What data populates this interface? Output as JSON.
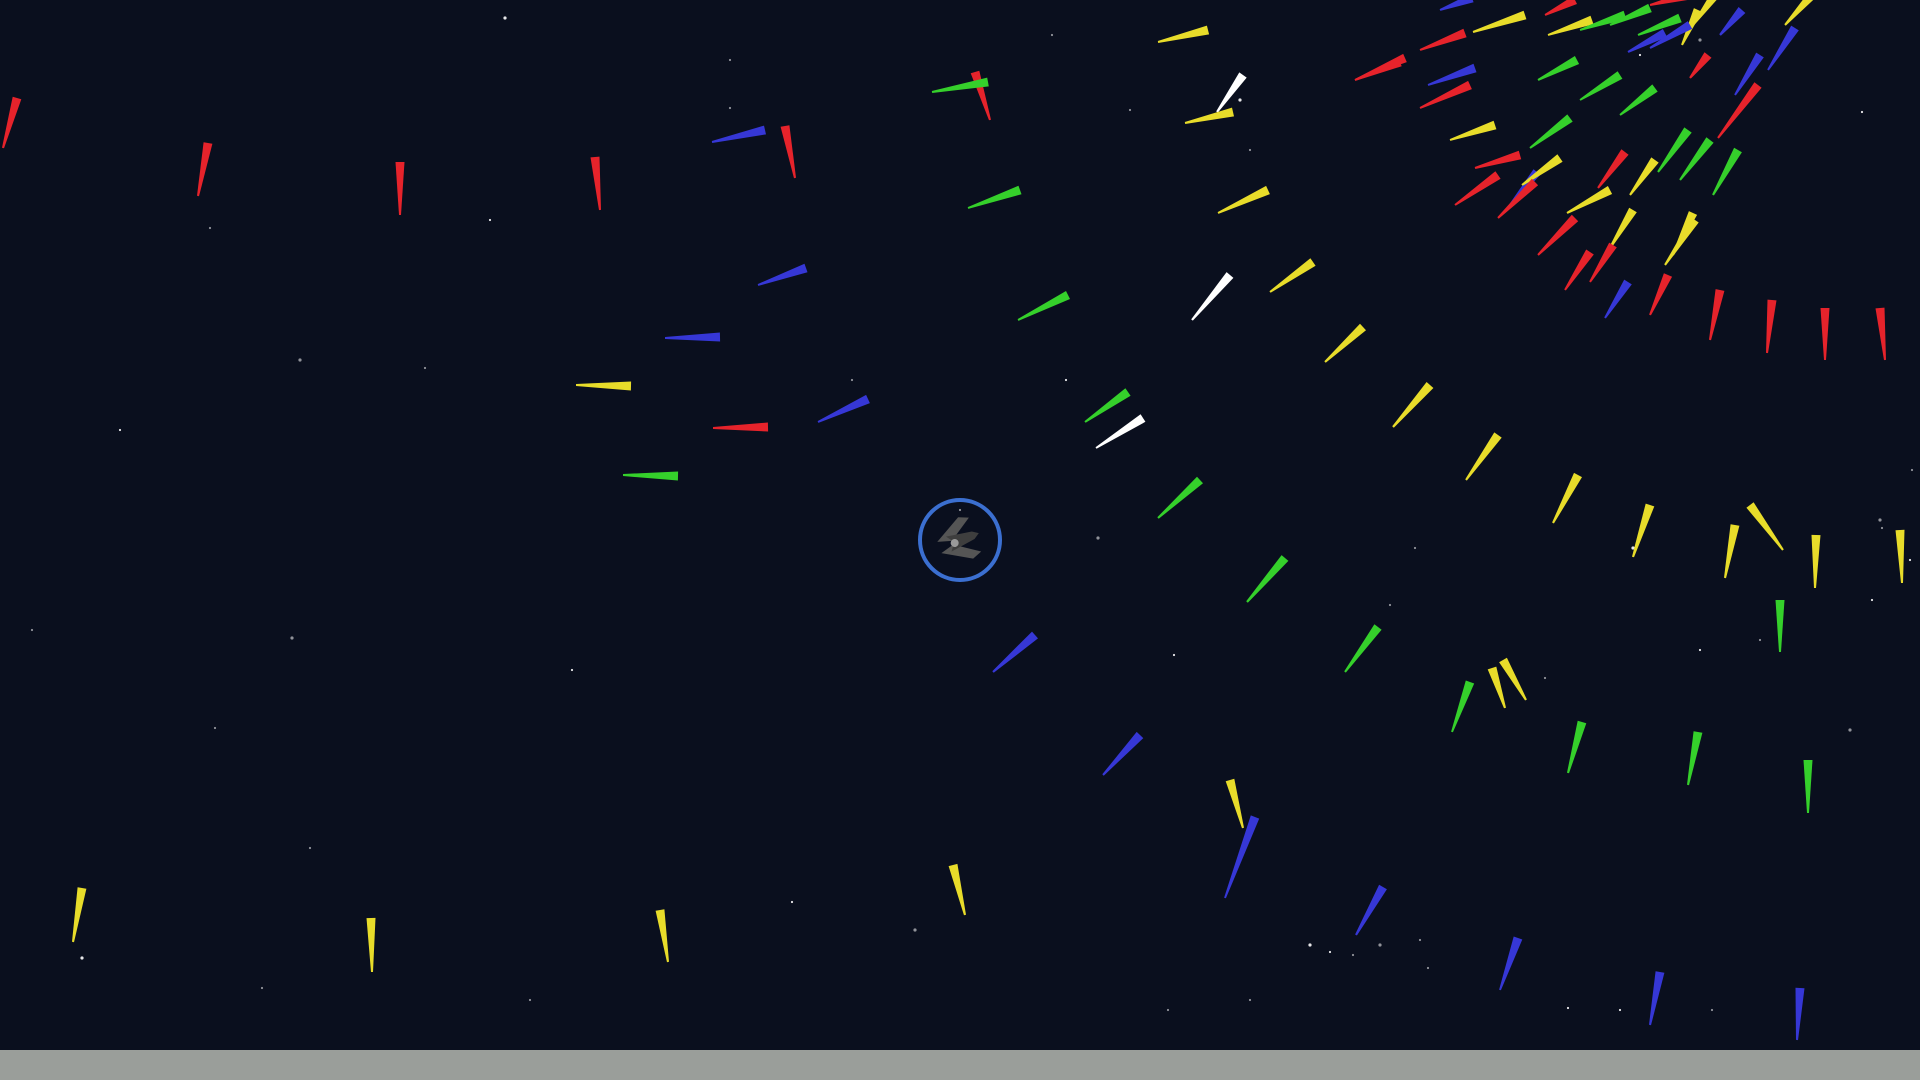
{
  "colors": {
    "background": "#0a0f1e",
    "star": "#ffffff",
    "red": "#e6232b",
    "yellow": "#e8dc2a",
    "green": "#35d02b",
    "blue": "#3637d6",
    "white": "#ffffff",
    "player_ring": "#3b6fd0",
    "player_body": "#4a4a4a",
    "bottom_bar": "#9a9e9a"
  },
  "player": {
    "icon": "spaceship-icon",
    "shield": "shield-ring"
  },
  "projectiles": {
    "icon": "bullet-icon",
    "colors_present": [
      "red",
      "yellow",
      "green",
      "blue",
      "white"
    ]
  },
  "bottom_bar": {
    "text": ""
  }
}
